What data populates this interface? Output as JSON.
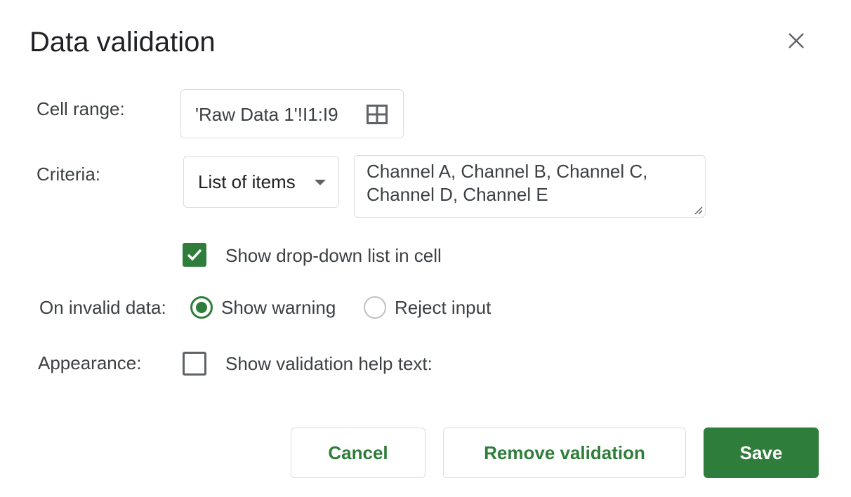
{
  "dialog": {
    "title": "Data validation"
  },
  "cell_range": {
    "label": "Cell range:",
    "value": "'Raw Data 1'!I1:I9",
    "icon": "grid-icon"
  },
  "criteria": {
    "label": "Criteria:",
    "selected": "List of items",
    "items_value": "Channel A, Channel B, Channel C, Channel D, Channel E"
  },
  "dropdown_option": {
    "label": "Show drop-down list in cell",
    "checked": true
  },
  "invalid_data": {
    "label": "On invalid data:",
    "options": [
      {
        "label": "Show warning",
        "selected": true
      },
      {
        "label": "Reject input",
        "selected": false
      }
    ]
  },
  "appearance": {
    "label": "Appearance:",
    "help_text_label": "Show validation help text:",
    "checked": false
  },
  "buttons": {
    "cancel": "Cancel",
    "remove": "Remove validation",
    "save": "Save"
  },
  "colors": {
    "accent": "#2f7d3a",
    "border": "#dadce0",
    "text": "#202124"
  }
}
